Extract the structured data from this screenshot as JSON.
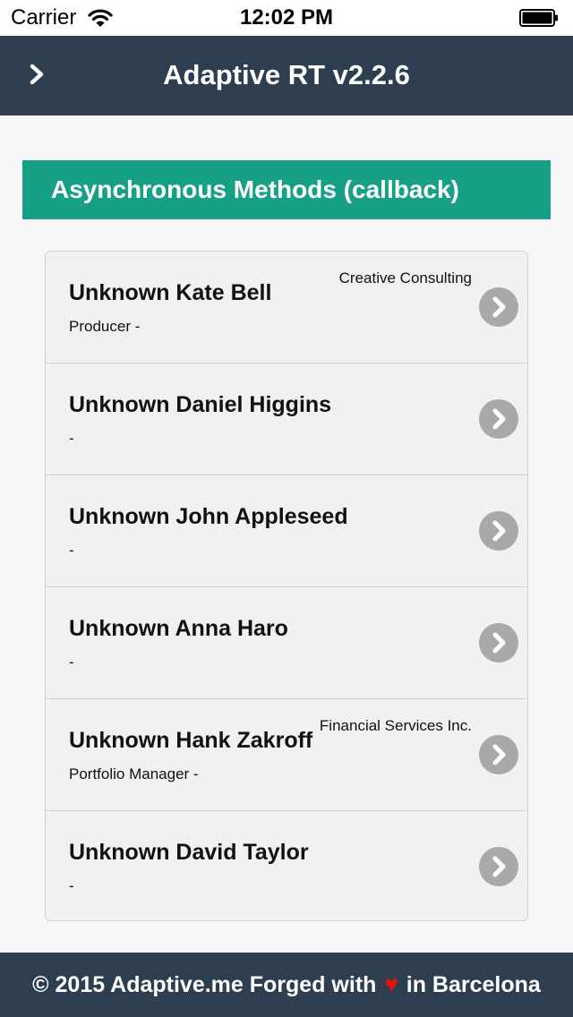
{
  "status_bar": {
    "carrier": "Carrier",
    "time": "12:02 PM",
    "wifi_icon": "wifi-icon",
    "battery_icon": "battery-icon"
  },
  "header": {
    "title": "Adaptive RT v2.2.6",
    "menu_icon": "chevron-right-icon",
    "background": "#2c3e50"
  },
  "section": {
    "title": "Asynchronous Methods (callback)",
    "background": "#16a085"
  },
  "contacts": [
    {
      "name": "Unknown Kate Bell",
      "company": "Creative Consulting",
      "subtitle": "Producer -"
    },
    {
      "name": "Unknown Daniel Higgins",
      "company": "",
      "subtitle": "-"
    },
    {
      "name": "Unknown John Appleseed",
      "company": "",
      "subtitle": "-"
    },
    {
      "name": "Unknown Anna Haro",
      "company": "",
      "subtitle": "-"
    },
    {
      "name": "Unknown Hank Zakroff",
      "company": "Financial Services Inc.",
      "subtitle": "Portfolio Manager -"
    },
    {
      "name": "Unknown David Taylor",
      "company": "",
      "subtitle": "-"
    }
  ],
  "footer": {
    "prefix": "© 2015 Adaptive.me Forged with",
    "heart": "♥",
    "suffix": "in Barcelona",
    "heart_color": "#e3120b"
  }
}
